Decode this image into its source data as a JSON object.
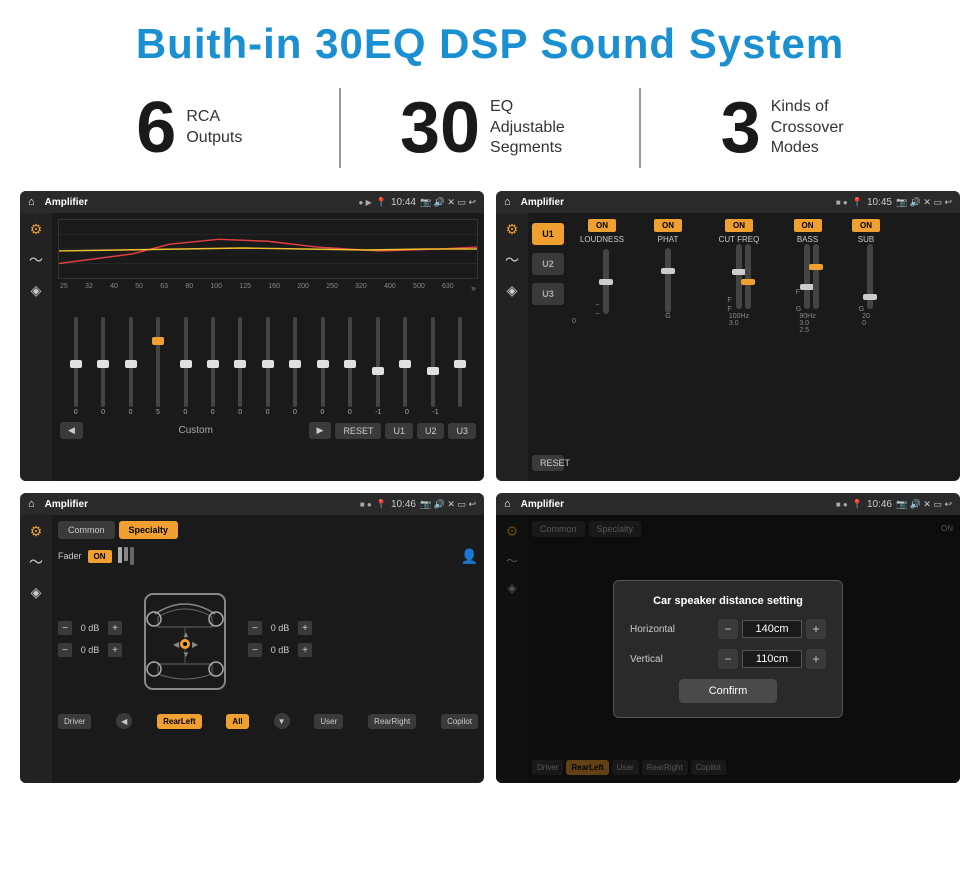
{
  "page": {
    "title": "Buith-in 30EQ DSP Sound System"
  },
  "stats": [
    {
      "number": "6",
      "label_line1": "RCA",
      "label_line2": "Outputs"
    },
    {
      "number": "30",
      "label_line1": "EQ Adjustable",
      "label_line2": "Segments"
    },
    {
      "number": "3",
      "label_line1": "Kinds of",
      "label_line2": "Crossover Modes"
    }
  ],
  "screens": [
    {
      "id": "eq-screen",
      "status_bar": {
        "title": "Amplifier",
        "time": "10:44"
      }
    },
    {
      "id": "crossover-screen",
      "status_bar": {
        "title": "Amplifier",
        "time": "10:45"
      }
    },
    {
      "id": "speaker-screen",
      "status_bar": {
        "title": "Amplifier",
        "time": "10:46"
      }
    },
    {
      "id": "distance-screen",
      "status_bar": {
        "title": "Amplifier",
        "time": "10:46"
      },
      "dialog": {
        "title": "Car speaker distance setting",
        "horizontal_label": "Horizontal",
        "horizontal_value": "140cm",
        "vertical_label": "Vertical",
        "vertical_value": "110cm",
        "confirm_label": "Confirm"
      }
    }
  ],
  "eq": {
    "frequencies": [
      "25",
      "32",
      "40",
      "50",
      "63",
      "80",
      "100",
      "125",
      "160",
      "200",
      "250",
      "320",
      "400",
      "500",
      "630"
    ],
    "values": [
      "0",
      "0",
      "0",
      "5",
      "0",
      "0",
      "0",
      "0",
      "0",
      "0",
      "0",
      "-1",
      "0",
      "-1",
      ""
    ],
    "presets": [
      "Custom",
      "RESET",
      "U1",
      "U2",
      "U3"
    ]
  },
  "crossover": {
    "units": [
      "U1",
      "U2",
      "U3"
    ],
    "controls": [
      "LOUDNESS",
      "PHAT",
      "CUT FREQ",
      "BASS",
      "SUB"
    ],
    "reset_label": "RESET"
  },
  "speaker": {
    "tabs": [
      "Common",
      "Specialty"
    ],
    "fader_label": "Fader",
    "fader_on": "ON",
    "footer_buttons": [
      "Driver",
      "RearLeft",
      "All",
      "User",
      "RearRight",
      "Copilot"
    ]
  },
  "distance_dialog": {
    "title": "Car speaker distance setting",
    "horizontal_label": "Horizontal",
    "horizontal_value": "140cm",
    "vertical_label": "Vertical",
    "vertical_value": "110cm",
    "confirm_label": "Confirm"
  }
}
